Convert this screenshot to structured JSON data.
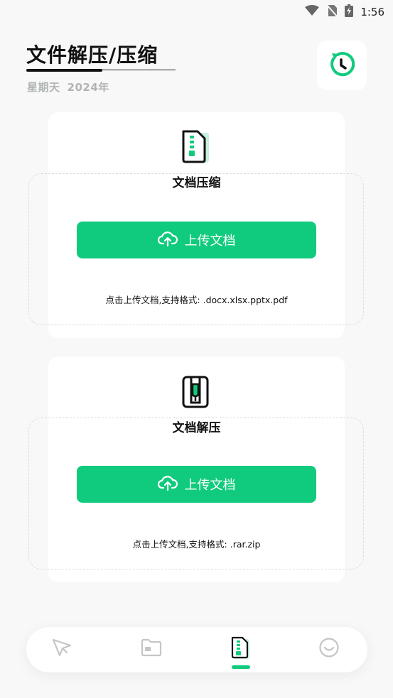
{
  "status_bar": {
    "time": "1:56",
    "icons": [
      "wifi-icon",
      "no-sim-icon",
      "battery-icon"
    ]
  },
  "header": {
    "title": "文件解压/压缩",
    "date_weekday": "星期天",
    "date_year": "2024年"
  },
  "cards": [
    {
      "icon": "zip-file-icon",
      "label": "文档压缩",
      "button_label": "上传文档",
      "hint": "点击上传文档,支持格式: .docx.xlsx.pptx.pdf"
    },
    {
      "icon": "zipper-icon",
      "label": "文档解压",
      "button_label": "上传文档",
      "hint": "点击上传文档,支持格式: .rar.zip"
    }
  ],
  "bottom_nav": {
    "items": [
      "send-icon",
      "folder-icon",
      "zip-document-icon",
      "profile-icon"
    ],
    "active_index": 2
  },
  "colors": {
    "accent": "#10cb7d",
    "background": "#f7f8f7",
    "text": "#111111",
    "muted": "#b0b4b2"
  }
}
